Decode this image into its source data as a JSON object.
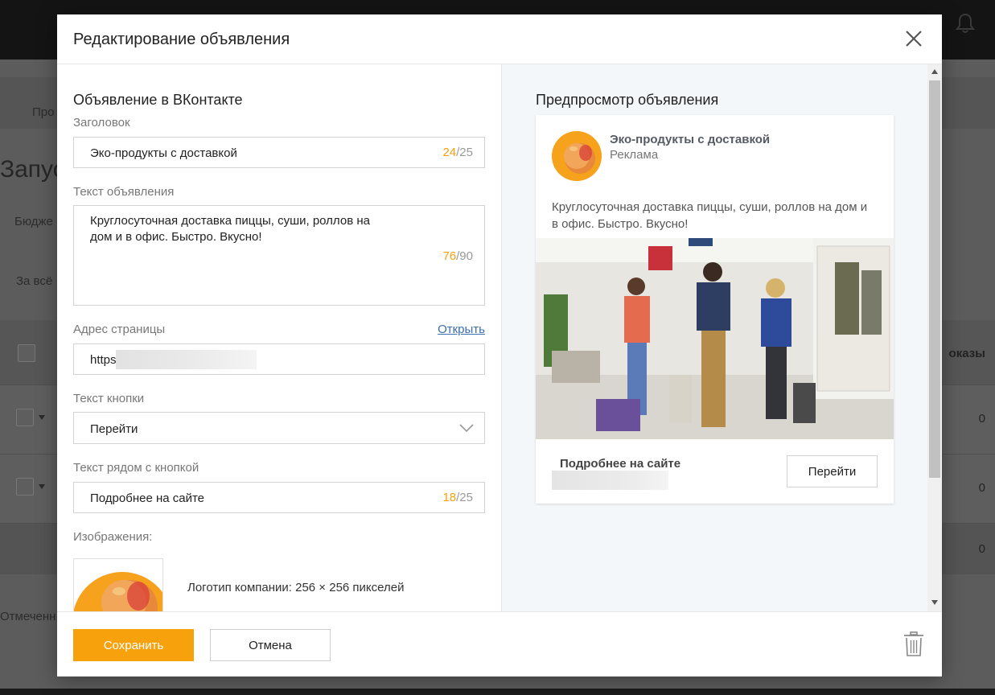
{
  "background": {
    "nav_partial": "Про",
    "page_title_partial": "Запус",
    "budget_partial": "Бюдже",
    "period_partial": "За всё",
    "column_partial": "оказы",
    "row_values": [
      "0",
      "0",
      "0"
    ],
    "footer_partial": "Отмеченн"
  },
  "modal": {
    "title": "Редактирование объявления",
    "close_icon": "close-icon"
  },
  "form": {
    "section_title": "Объявление в ВКонтакте",
    "headline": {
      "label": "Заголовок",
      "value": "Эко-продукты с доставкой",
      "count": "24",
      "max": "/25"
    },
    "ad_text": {
      "label": "Текст объявления",
      "line1": "Круглосуточная доставка пиццы, суши, роллов на",
      "line2": "дом и в офис. Быстро. Вкусно!",
      "count": "76",
      "max": "/90"
    },
    "page_url": {
      "label": "Адрес страницы",
      "open_link": "Открыть",
      "value": "https"
    },
    "button_text": {
      "label": "Текст кнопки",
      "selected": "Перейти"
    },
    "side_text": {
      "label": "Текст рядом с кнопкой",
      "value": "Подробнее на сайте",
      "count": "18",
      "max": "/25"
    },
    "images": {
      "label": "Изображения:",
      "logo_description": "Логотип компании: 256 × 256 пикселей"
    }
  },
  "preview": {
    "title": "Предпросмотр объявления",
    "advertiser": "Эко-продукты с доставкой",
    "sponsored": "Реклама",
    "text": "Круглосуточная доставка пиццы, суши, роллов на дом и в офис. Быстро. Вкусно!",
    "more_label": "Подробнее на сайте",
    "button": "Перейти"
  },
  "footer": {
    "save": "Сохранить",
    "cancel": "Отмена"
  },
  "colors": {
    "accent": "#f7a10c",
    "link": "#3a6fb0"
  }
}
